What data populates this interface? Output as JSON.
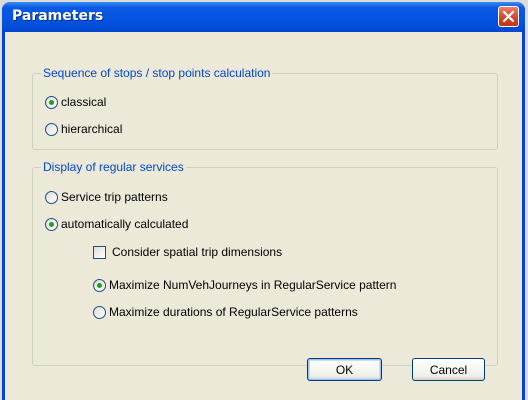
{
  "window": {
    "title": "Parameters"
  },
  "icons": {
    "close": "close-icon"
  },
  "colors": {
    "titlebar": "#0454e0",
    "legend_text": "#0046d5",
    "radio_dot": "#21a121",
    "close_button": "#d2482c",
    "dialog_background": "#ece9d8"
  },
  "stop_sequence": {
    "legend": "Sequence of stops / stop points calculation",
    "options": [
      {
        "label": "classical",
        "selected": true
      },
      {
        "label": "hierarchical",
        "selected": false
      }
    ]
  },
  "regular_services": {
    "legend": "Display of regular services",
    "options": [
      {
        "label": "Service trip patterns",
        "selected": false
      },
      {
        "label": "automatically calculated",
        "selected": true
      }
    ],
    "spatial_checkbox": {
      "label": "Consider spatial trip dimensions",
      "checked": false
    },
    "maximize_options": [
      {
        "label": "Maximize NumVehJourneys in RegularService pattern",
        "selected": true
      },
      {
        "label": "Maximize durations of RegularService patterns",
        "selected": false
      }
    ]
  },
  "buttons": {
    "ok": "OK",
    "cancel": "Cancel"
  }
}
